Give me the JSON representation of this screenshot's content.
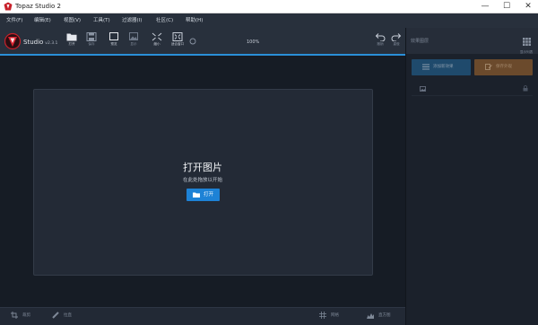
{
  "window": {
    "title": "Topaz Studio 2",
    "minimize": "—",
    "maximize": "☐",
    "close": "✕"
  },
  "menu": [
    {
      "label": "文件(F)"
    },
    {
      "label": "编辑(E)"
    },
    {
      "label": "视图(V)"
    },
    {
      "label": "工具(T)"
    },
    {
      "label": "过滤器(I)"
    },
    {
      "label": "社区(C)"
    },
    {
      "label": "帮助(H)"
    }
  ],
  "toolbar": {
    "brand": "Studio",
    "version": "v2.3.1",
    "tools": [
      {
        "label": "打开",
        "icon": "folder-icon"
      },
      {
        "label": "保存",
        "icon": "save-icon"
      },
      {
        "label": "预览",
        "icon": "compare-icon"
      },
      {
        "label": "显示",
        "icon": "image-icon"
      },
      {
        "label": "缩小",
        "icon": "shrink-icon"
      },
      {
        "label": "适合窗口",
        "icon": "fit-icon"
      }
    ],
    "zoom": "100%",
    "undo_label": "撤销",
    "redo_label": "重做"
  },
  "canvas": {
    "title": "打开图片",
    "subtitle": "在此处拖放以开始",
    "open_button": "打开"
  },
  "bottom": {
    "crop": "裁剪",
    "straighten": "拉直",
    "grid": "网格",
    "histogram": "直方图"
  },
  "right_panel": {
    "title": "效果图层",
    "grid_label": "显示列表",
    "add_effect": "添加新效果",
    "save_look": "保存外观"
  },
  "colors": {
    "accent": "#2a8fd8",
    "button_blue": "#1d82d6",
    "panel_bg": "#1b212b",
    "toolbar_bg": "#28303c"
  }
}
